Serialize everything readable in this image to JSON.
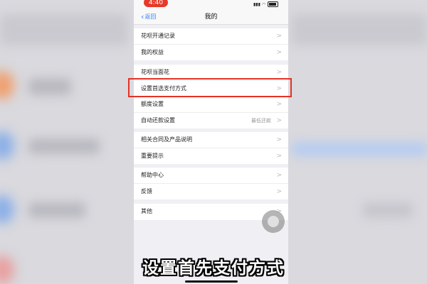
{
  "status_bar": {
    "time": "4:40"
  },
  "nav": {
    "back_label": "返回",
    "title": "我的"
  },
  "groups": [
    {
      "items": [
        {
          "label": "花呗开通记录"
        },
        {
          "label": "我的权益"
        }
      ]
    },
    {
      "items": [
        {
          "label": "花呗当面花"
        },
        {
          "label": "设置首选支付方式",
          "highlighted": true
        },
        {
          "label": "额度设置"
        },
        {
          "label": "自动还款设置",
          "value": "最低还款"
        }
      ]
    },
    {
      "items": [
        {
          "label": "相关合同及产品说明"
        },
        {
          "label": "重要提示"
        }
      ]
    },
    {
      "items": [
        {
          "label": "帮助中心"
        },
        {
          "label": "反馈"
        }
      ]
    },
    {
      "items": [
        {
          "label": "其他"
        }
      ]
    }
  ],
  "arrow_glyph": ">",
  "caption": "设置首先支付方式",
  "colors": {
    "highlight": "#e33325",
    "accent": "#2b7cf6",
    "time_pill": "#e53929"
  },
  "icons": [
    "chevron-left-icon",
    "chevron-right-icon",
    "signal-icon",
    "wifi-icon",
    "battery-icon",
    "assistive-touch-icon"
  ]
}
